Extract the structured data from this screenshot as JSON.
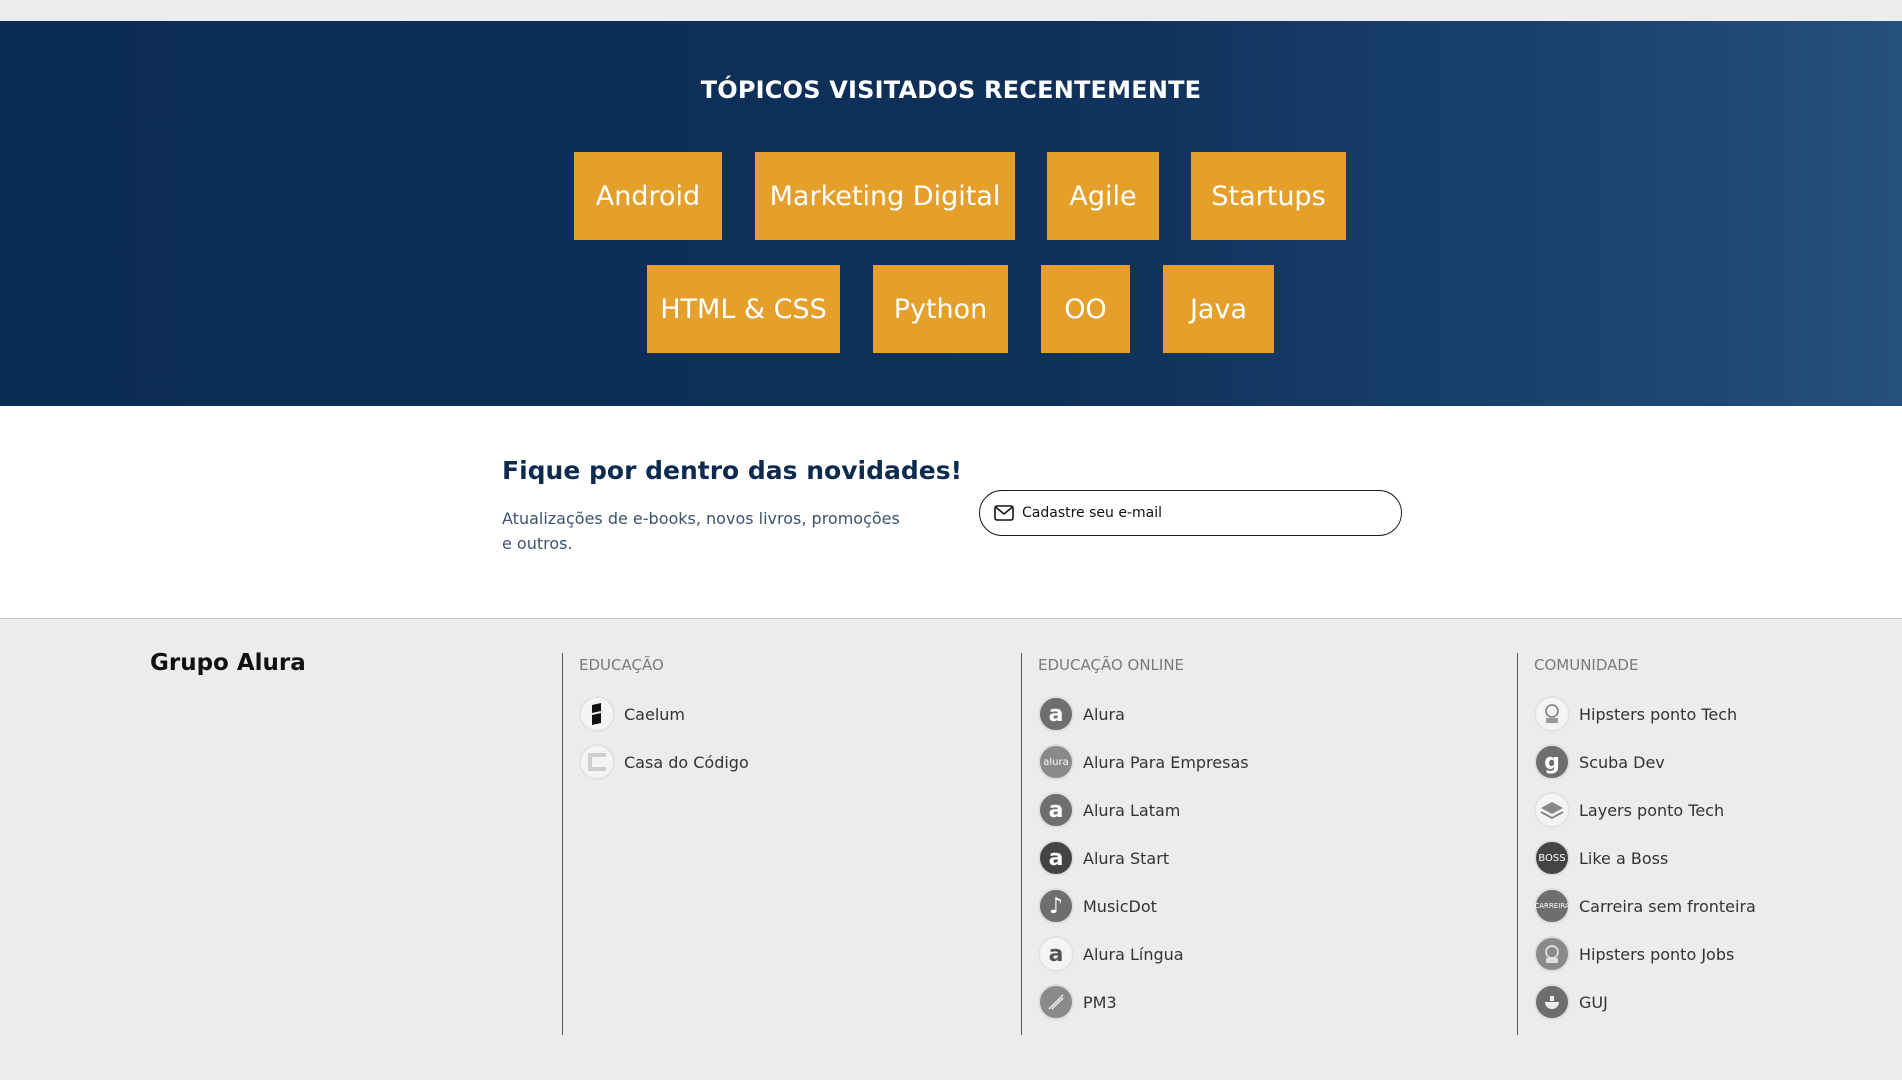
{
  "topics": {
    "title": "TÓPICOS VISITADOS RECENTEMENTE",
    "items": [
      "Android",
      "Marketing Digital",
      "Agile",
      "Startups",
      "HTML & CSS",
      "Python",
      "OO",
      "Java"
    ],
    "button_color": "#e5a02c",
    "background_color": "#0b2c55"
  },
  "newsletter": {
    "title": "Fique por dentro das novidades!",
    "description": "Atualizações de e-books, novos livros, promoções e outros.",
    "email_placeholder": "Cadastre seu e-mail",
    "email_icon": "mail-icon"
  },
  "footer": {
    "brand": "Grupo Alura",
    "columns": [
      {
        "title": "EDUCAÇÃO",
        "items": [
          {
            "label": "Caelum",
            "icon": "caelum-logo-icon"
          },
          {
            "label": "Casa do Código",
            "icon": "casa-do-codigo-logo-icon"
          }
        ]
      },
      {
        "title": "EDUCAÇÃO ONLINE",
        "items": [
          {
            "label": "Alura",
            "icon": "alura-logo-icon"
          },
          {
            "label": "Alura Para Empresas",
            "icon": "alura-empresas-logo-icon"
          },
          {
            "label": "Alura Latam",
            "icon": "alura-latam-logo-icon"
          },
          {
            "label": "Alura Start",
            "icon": "alura-start-logo-icon"
          },
          {
            "label": "MusicDot",
            "icon": "musicdot-logo-icon"
          },
          {
            "label": "Alura Língua",
            "icon": "alura-lingua-logo-icon"
          },
          {
            "label": "PM3",
            "icon": "pm3-logo-icon"
          }
        ]
      },
      {
        "title": "COMUNIDADE",
        "items": [
          {
            "label": "Hipsters ponto Tech",
            "icon": "hipsters-tech-logo-icon"
          },
          {
            "label": "Scuba Dev",
            "icon": "scuba-dev-logo-icon"
          },
          {
            "label": "Layers ponto Tech",
            "icon": "layers-tech-logo-icon"
          },
          {
            "label": "Like a Boss",
            "icon": "like-a-boss-logo-icon"
          },
          {
            "label": "Carreira sem fronteira",
            "icon": "carreira-sem-fronteira-logo-icon"
          },
          {
            "label": "Hipsters ponto Jobs",
            "icon": "hipsters-jobs-logo-icon"
          },
          {
            "label": "GUJ",
            "icon": "guj-logo-icon"
          }
        ]
      }
    ]
  }
}
